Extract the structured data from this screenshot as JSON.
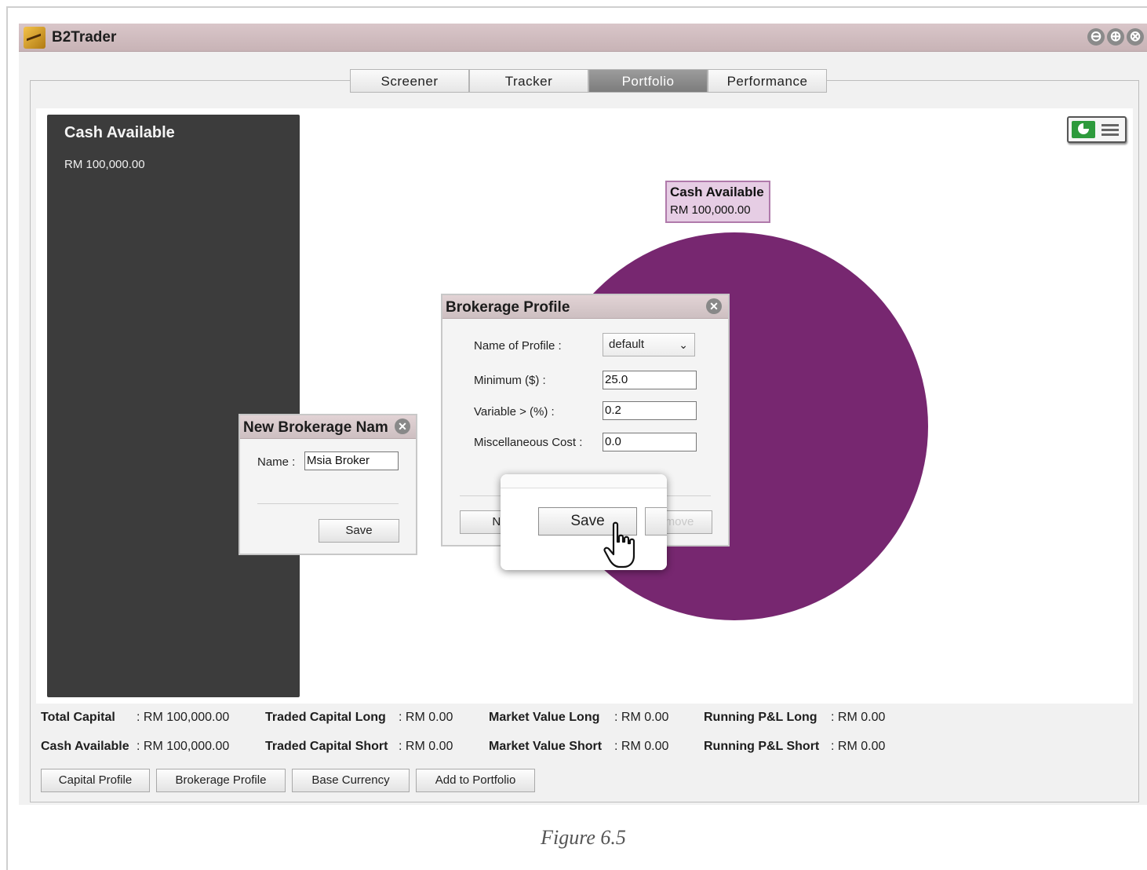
{
  "window": {
    "title": "B2Trader",
    "controls": [
      "⊖",
      "⊕",
      "⊗"
    ]
  },
  "tabs": [
    {
      "label": "Screener",
      "active": false
    },
    {
      "label": "Tracker",
      "active": false
    },
    {
      "label": "Portfolio",
      "active": true
    },
    {
      "label": "Performance",
      "active": false
    }
  ],
  "cash_panel": {
    "title": "Cash Available",
    "value": "RM 100,000.00"
  },
  "chart_data": {
    "type": "pie",
    "slices": [
      {
        "label": "Cash Available",
        "value": 100000,
        "display": "RM 100,000.00",
        "color": "#772770"
      }
    ]
  },
  "brokerage_profile": {
    "title": "Brokerage Profile",
    "name_label": "Name of Profile :",
    "name_value": "default",
    "minimum_label": "Minimum ($) :",
    "minimum_value": "25.0",
    "variable_label": "Variable > (%) :",
    "variable_value": "0.2",
    "misc_label": "Miscellaneous Cost :",
    "misc_value": "0.0",
    "new_button_partial": "Ne",
    "remove_button_partial": "move"
  },
  "new_brokerage_name": {
    "title": "New Brokerage Nam",
    "name_label": "Name :",
    "name_value": "Msia Broker",
    "save_label": "Save"
  },
  "zoom_callout": {
    "save_label": "Save"
  },
  "stats": {
    "total_capital": {
      "label": "Total Capital",
      "value": ": RM 100,000.00"
    },
    "cash_available": {
      "label": "Cash Available",
      "value": ": RM 100,000.00"
    },
    "traded_capital_long": {
      "label": "Traded Capital Long",
      "value": ": RM 0.00"
    },
    "traded_capital_short": {
      "label": "Traded Capital Short",
      "value": ": RM 0.00"
    },
    "market_value_long": {
      "label": "Market Value Long",
      "value": ": RM 0.00"
    },
    "market_value_short": {
      "label": "Market Value Short",
      "value": ": RM 0.00"
    },
    "running_pl_long": {
      "label": "Running P&L Long",
      "value": ": RM 0.00"
    },
    "running_pl_short": {
      "label": "Running P&L Short",
      "value": ": RM 0.00"
    }
  },
  "bottom_buttons": {
    "capital_profile": "Capital Profile",
    "brokerage_profile": "Brokerage Profile",
    "base_currency": "Base Currency",
    "add_to_portfolio": "Add to Portfolio"
  },
  "caption": "Figure 6.5"
}
